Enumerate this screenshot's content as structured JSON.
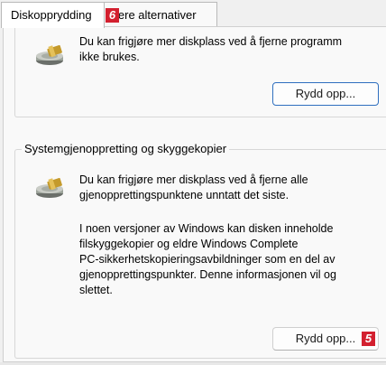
{
  "tabs": [
    {
      "label": "Diskopprydding",
      "active": true
    },
    {
      "label": "Flere alternativer",
      "visible_label": "lere alternativer",
      "active": false
    }
  ],
  "markers": {
    "tab_marker": "6",
    "button_marker": "5"
  },
  "programs_section": {
    "lines": [
      "Du kan frigjøre mer diskplass ved å fjerne programm",
      "ikke brukes."
    ],
    "button_label": "Rydd opp..."
  },
  "restore_section": {
    "legend": "Systemgjenoppretting og skyggekopier",
    "lines_1": [
      "Du kan frigjøre mer diskplass ved å fjerne alle",
      "gjenopprettingspunktene unntatt det siste."
    ],
    "lines_2": [
      "I noen versjoner av Windows kan disken inneholde",
      "filskyggekopier og eldre Windows Complete",
      "PC-sikkerhetskopieringsavbildninger som en del av",
      "gjenopprettingspunkter. Denne informasjonen vil og",
      "slettet."
    ],
    "button_label": "Rydd opp..."
  },
  "icons": [
    "disk-cleanup-icon",
    "disk-cleanup-icon"
  ],
  "colors": {
    "marker": "#d3202f",
    "focus_border": "#2f6fbf",
    "window_bg": "#f0f0f0"
  }
}
